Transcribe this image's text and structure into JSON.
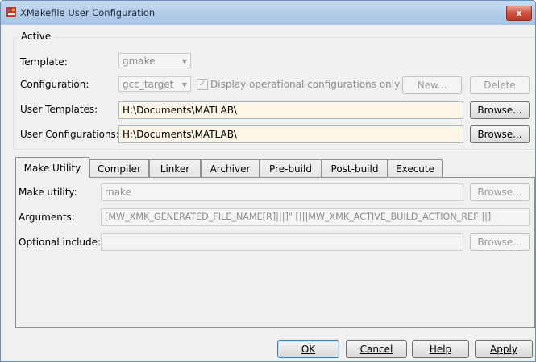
{
  "window": {
    "title": "XMakefile User Configuration",
    "close_symbol": "x",
    "app_icon": "matlab-simulink-icon"
  },
  "active": {
    "group_title": "Active",
    "template_label": "Template:",
    "template_value": "gmake",
    "configuration_label": "Configuration:",
    "configuration_value": "gcc_target",
    "display_operational_label": "Display operational configurations only",
    "display_operational_checked": true,
    "new_button": "New...",
    "delete_button": "Delete",
    "user_templates_label": "User Templates:",
    "user_templates_value": "H:\\Documents\\MATLAB\\",
    "user_configurations_label": "User Configurations:",
    "user_configurations_value": "H:\\Documents\\MATLAB\\",
    "browse_button": "Browse..."
  },
  "tabs": [
    "Make Utility",
    "Compiler",
    "Linker",
    "Archiver",
    "Pre-build",
    "Post-build",
    "Execute"
  ],
  "active_tab": "Make Utility",
  "make_utility": {
    "make_utility_label": "Make utility:",
    "make_utility_value": "make",
    "arguments_label": "Arguments:",
    "arguments_value": "[MW_XMK_GENERATED_FILE_NAME[R]|||]\" [|||MW_XMK_ACTIVE_BUILD_ACTION_REF|||]",
    "optional_include_label": "Optional include:",
    "optional_include_value": "",
    "browse_button": "Browse..."
  },
  "footer": {
    "ok": "OK",
    "cancel": "Cancel",
    "help": "Help",
    "apply": "Apply"
  }
}
